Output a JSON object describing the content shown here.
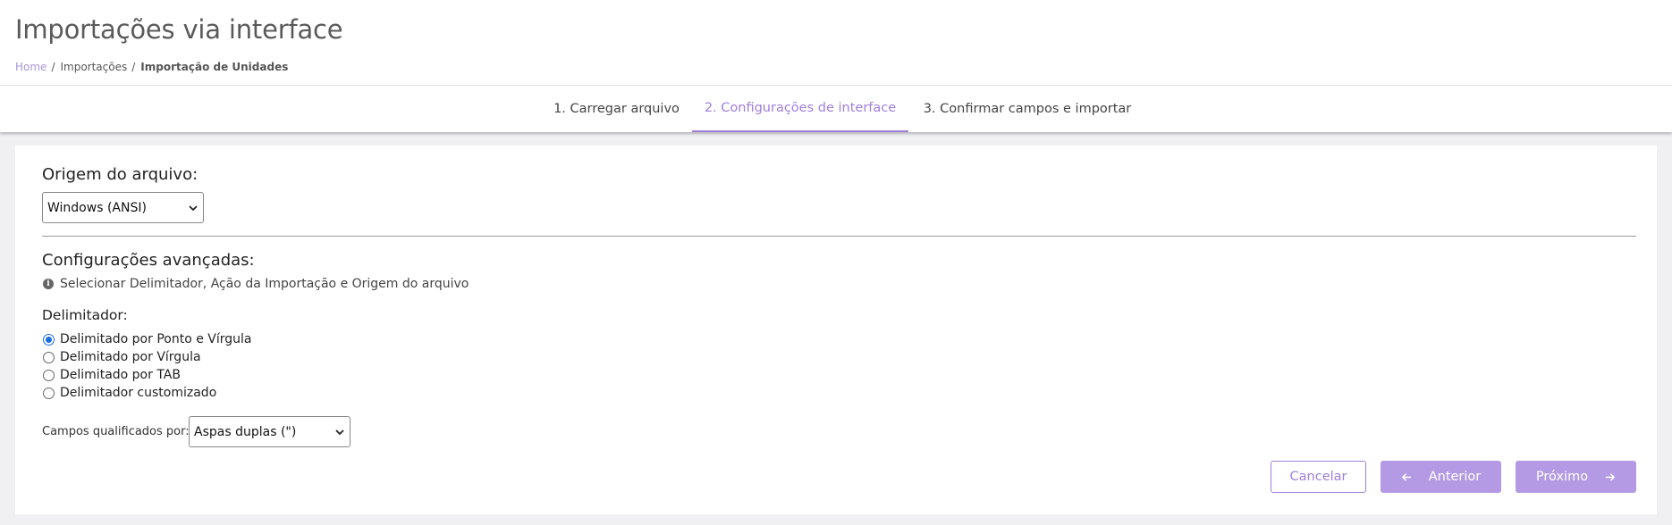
{
  "header": {
    "title": "Importações via interface",
    "breadcrumb": [
      {
        "label": "Home"
      },
      {
        "label": "Importações"
      },
      {
        "label": "Importação de Unidades"
      }
    ],
    "separator": "/"
  },
  "tabs": [
    {
      "label": "1. Carregar arquivo",
      "active": false
    },
    {
      "label": "2. Configurações de interface",
      "active": true
    },
    {
      "label": "3. Confirmar campos e importar",
      "active": false
    }
  ],
  "origin": {
    "title": "Origem do arquivo:",
    "selected": "Windows (ANSI)"
  },
  "advanced": {
    "title": "Configurações avançadas:",
    "info_icon": "info-icon",
    "info_text": "Selecionar Delimitador, Ação da Importação e Origem do arquivo"
  },
  "delimiter": {
    "title": "Delimitador:",
    "options": [
      {
        "label": "Delimitado por Ponto e Vírgula",
        "checked": true
      },
      {
        "label": "Delimitado por Vírgula",
        "checked": false
      },
      {
        "label": "Delimitado por TAB",
        "checked": false
      },
      {
        "label": "Delimitador customizado",
        "checked": false
      }
    ]
  },
  "qualifier": {
    "label": "Campos qualificados por:",
    "selected": "Aspas duplas (\")"
  },
  "actions": {
    "cancel": "Cancelar",
    "previous": "Anterior",
    "next": "Próximo"
  },
  "colors": {
    "accent": "#a07fdc",
    "primary_button": "#b49ae4",
    "radio_checked": "#1a6ee0",
    "breadcrumb_home": "#a995d8"
  }
}
